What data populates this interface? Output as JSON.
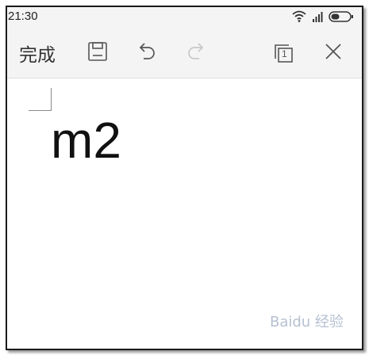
{
  "status_bar": {
    "time": "21:30",
    "icons": [
      "wifi-icon",
      "signal-icon",
      "battery-icon"
    ]
  },
  "toolbar": {
    "done_label": "完成",
    "buttons": [
      "save-icon",
      "undo-icon",
      "redo-icon",
      "page-count-icon",
      "close-icon"
    ],
    "page_count": "1",
    "redo_enabled": false
  },
  "document": {
    "text": "m2"
  },
  "watermark": {
    "text": "Baidu 经验"
  },
  "colors": {
    "toolbar_bg": "#f4f4f4",
    "icon": "#555555",
    "icon_disabled": "#c8c8c8",
    "text": "#111111"
  }
}
